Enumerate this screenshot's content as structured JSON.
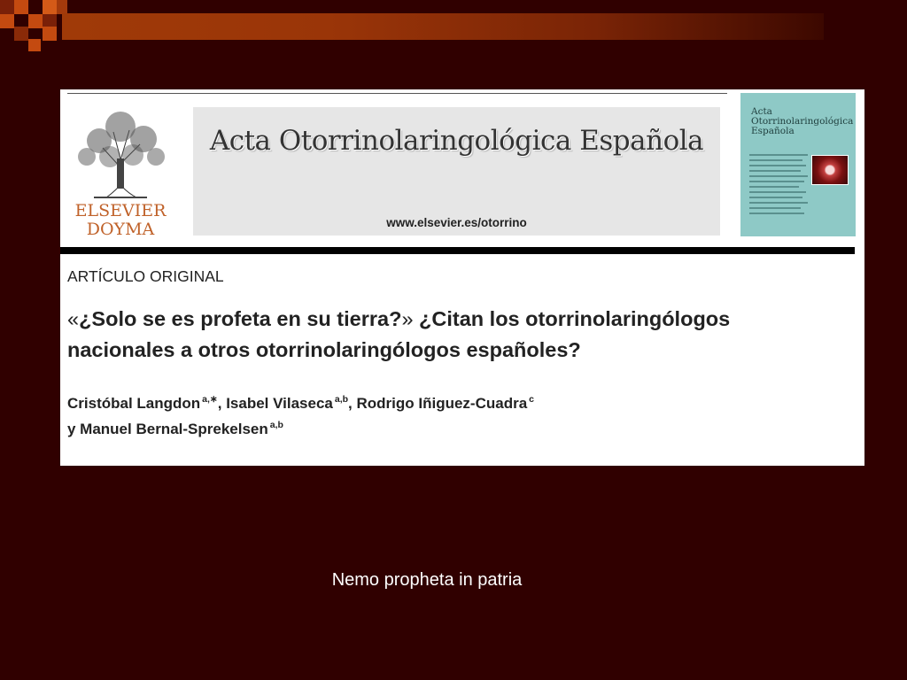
{
  "publisher": {
    "logo_line1": "ELSEVIER",
    "logo_line2": "DOYMA"
  },
  "journal": {
    "title": "Acta Otorrinolaringológica Española",
    "url": "www.elsevier.es/otorrino",
    "cover_title_1": "Acta",
    "cover_title_2": "Otorrinolaringológica",
    "cover_title_3": "Española"
  },
  "article": {
    "section": "ARTÍCULO ORIGINAL",
    "open_quote": "«",
    "quoted_title": "¿Solo se es profeta en su tierra?",
    "close_quote": "»",
    "title_rest_1": " ¿Citan los otorrinolaringólogos",
    "title_line2": "nacionales a otros otorrinolaringólogos españoles?",
    "authors": [
      {
        "name": "Cristóbal Langdon",
        "aff": "a,∗",
        "sep": ", "
      },
      {
        "name": "Isabel Vilaseca",
        "aff": "a,b",
        "sep": ", "
      },
      {
        "name": "Rodrigo Iñiguez-Cuadra",
        "aff": "c",
        "sep": ""
      },
      {
        "name": "y Manuel Bernal-Sprekelsen",
        "aff": "a,b",
        "sep": ""
      }
    ]
  },
  "caption": "Nemo propheta in patria",
  "colors": {
    "background": "#300000",
    "accent_bar": "#a03a08",
    "accent_square": "#c44a10",
    "cover": "#8ec9c6"
  }
}
